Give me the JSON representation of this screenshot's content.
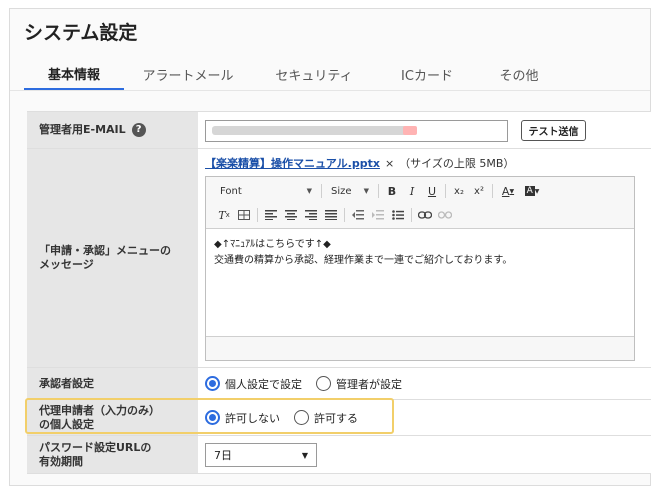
{
  "page": {
    "title": "システム設定"
  },
  "tabs": [
    {
      "label": "基本情報",
      "active": true
    },
    {
      "label": "アラートメール",
      "active": false
    },
    {
      "label": "セキュリティ",
      "active": false
    },
    {
      "label": "ICカード",
      "active": false
    },
    {
      "label": "その他",
      "active": false
    }
  ],
  "admin_email": {
    "label": "管理者用E-MAIL",
    "help_icon": "?",
    "value": "",
    "test_button": "テスト送信"
  },
  "message": {
    "label_line1": "「申請・承認」メニューの",
    "label_line2": "メッセージ",
    "attachment_name": "【楽楽精算】操作マニュアル.pptx",
    "remove_icon": "×",
    "size_note": "（サイズの上限 5MB）",
    "toolbar": {
      "font_label": "Font",
      "size_label": "Size",
      "bold": "B",
      "italic": "I",
      "underline": "U",
      "subscript": "x₂",
      "superscript": "x²",
      "text_color": "A",
      "bg_color": "A"
    },
    "body_line1": "◆↑ﾏﾆｭｱﾙはこちらです↑◆",
    "body_line2": "交通費の精算から承認、経理作業まで一連でご紹介しております。"
  },
  "approver": {
    "label": "承認者設定",
    "options": [
      {
        "label": "個人設定で設定",
        "checked": true
      },
      {
        "label": "管理者が設定",
        "checked": false
      }
    ]
  },
  "proxy": {
    "label_line1": "代理申請者（入力のみ）",
    "label_line2": "の個人設定",
    "options": [
      {
        "label": "許可しない",
        "checked": true
      },
      {
        "label": "許可する",
        "checked": false
      }
    ]
  },
  "password_url": {
    "label_line1": "パスワード設定URLの",
    "label_line2": "有効期間",
    "selected": "7日"
  },
  "colors": {
    "accent": "#2d6cdf",
    "highlight": "#f2cf6a",
    "link": "#1a4fa8"
  }
}
